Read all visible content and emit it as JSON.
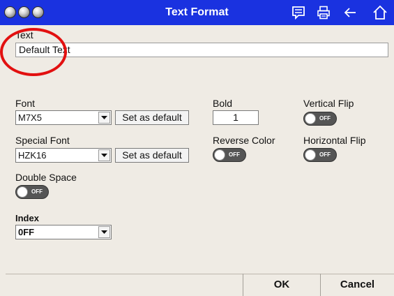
{
  "window": {
    "title": "Text Format",
    "icons": [
      "comment-icon",
      "printer-icon",
      "back-arrow-icon",
      "home-icon"
    ]
  },
  "text_section": {
    "label": "Text",
    "value": "Default Text"
  },
  "font": {
    "label": "Font",
    "value": "M7X5",
    "set_default_label": "Set as default"
  },
  "special_font": {
    "label": "Special Font",
    "value": "HZK16",
    "set_default_label": "Set as default"
  },
  "double_space": {
    "label": "Double Space",
    "state": "OFF"
  },
  "index": {
    "label": "Index",
    "value": "0FF"
  },
  "bold": {
    "label": "Bold",
    "value": "1"
  },
  "reverse_color": {
    "label": "Reverse Color",
    "state": "OFF"
  },
  "vertical_flip": {
    "label": "Vertical Flip",
    "state": "OFF"
  },
  "horizontal_flip": {
    "label": "Horizontal Flip",
    "state": "OFF"
  },
  "footer": {
    "ok_label": "OK",
    "cancel_label": "Cancel"
  },
  "colors": {
    "titlebar": "#1a32e0",
    "background": "#efebe4",
    "annotation": "#e21010"
  }
}
